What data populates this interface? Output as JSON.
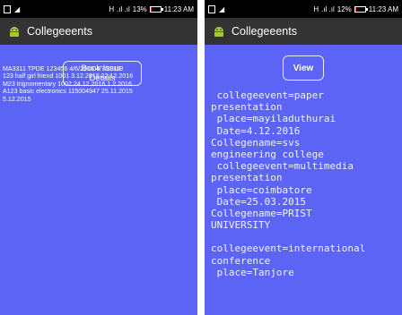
{
  "screen_left": {
    "status": {
      "sim": "H",
      "battery": "13%",
      "battery_level": 0.13,
      "time": "11:23 AM"
    },
    "app_title": "Collegeeents",
    "button_label": "Book Issue Details",
    "records": [
      "MA3311  TPDE  123456  4/6/2016  4/7/2016",
      "123  half girl friend  1001  3.12.2016  22.12.2016",
      "M23  trignomentary  1002  24.12.2016  1.2.2016",
      "A123  basic electronics  115004947  25.11.2015",
      "5.12.2015"
    ]
  },
  "screen_right": {
    "status": {
      "sim": "H",
      "battery": "12%",
      "battery_level": 0.12,
      "time": "11:23 AM"
    },
    "app_title": "Collegeeents",
    "button_label": "View",
    "lines": [
      " collegeevent=paper",
      "presentation",
      " place=mayiladuthurai",
      " Date=4.12.2016",
      "Collegename=svs",
      "engineering college",
      " collegeevent=multimedia",
      "presentation",
      " place=coimbatore",
      " Date=25.03.2015",
      "Collegename=PRIST",
      "UNIVERSITY",
      "",
      "collegeevent=international",
      "conference",
      " place=Tanjore"
    ]
  },
  "colors": {
    "background": "#5c64f5",
    "appbar": "#333333",
    "statusbar": "#000000",
    "battery_low": "#e53935",
    "android_green": "#a4c639"
  }
}
